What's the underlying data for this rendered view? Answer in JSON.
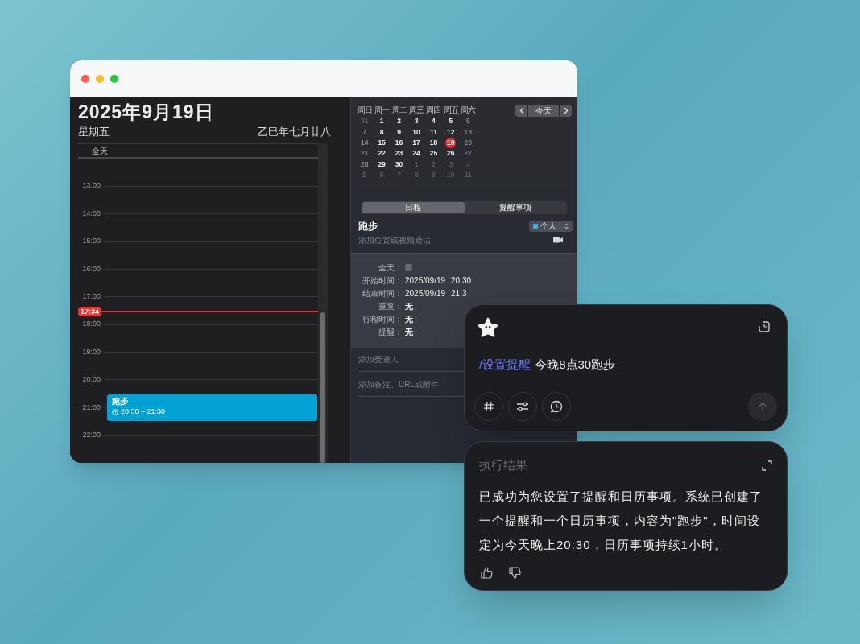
{
  "day_view": {
    "date_title": "2025年9月19日",
    "weekday": "星期五",
    "lunar_date": "乙巳年七月廿八",
    "all_day_label": "全天",
    "hours": [
      "13:00",
      "14:00",
      "15:00",
      "16:00",
      "17:00",
      "18:00",
      "19:00",
      "20:00",
      "21:00",
      "22:00"
    ],
    "current_time": "17:34",
    "events": [
      {
        "title": "跑步",
        "time": "20:30 – 21:30"
      }
    ]
  },
  "mini_calendar": {
    "weekdays": [
      "周日",
      "周一",
      "周二",
      "周三",
      "周四",
      "周五",
      "周六"
    ],
    "weeks": [
      [
        {
          "day": "31",
          "in_month": false,
          "selected": false
        },
        {
          "day": "1",
          "in_month": true,
          "selected": false
        },
        {
          "day": "2",
          "in_month": true,
          "selected": false
        },
        {
          "day": "3",
          "in_month": true,
          "selected": false
        },
        {
          "day": "4",
          "in_month": true,
          "selected": false
        },
        {
          "day": "5",
          "in_month": true,
          "selected": false
        },
        {
          "day": "6",
          "in_month": true,
          "selected": false
        }
      ],
      [
        {
          "day": "7",
          "in_month": true,
          "selected": false
        },
        {
          "day": "8",
          "in_month": true,
          "selected": false
        },
        {
          "day": "9",
          "in_month": true,
          "selected": false
        },
        {
          "day": "10",
          "in_month": true,
          "selected": false
        },
        {
          "day": "11",
          "in_month": true,
          "selected": false
        },
        {
          "day": "12",
          "in_month": true,
          "selected": false
        },
        {
          "day": "13",
          "in_month": true,
          "selected": false
        }
      ],
      [
        {
          "day": "14",
          "in_month": true,
          "selected": false
        },
        {
          "day": "15",
          "in_month": true,
          "selected": false
        },
        {
          "day": "16",
          "in_month": true,
          "selected": false
        },
        {
          "day": "17",
          "in_month": true,
          "selected": false
        },
        {
          "day": "18",
          "in_month": true,
          "selected": false
        },
        {
          "day": "19",
          "in_month": true,
          "selected": true
        },
        {
          "day": "20",
          "in_month": true,
          "selected": false
        }
      ],
      [
        {
          "day": "21",
          "in_month": true,
          "selected": false
        },
        {
          "day": "22",
          "in_month": true,
          "selected": false
        },
        {
          "day": "23",
          "in_month": true,
          "selected": false
        },
        {
          "day": "24",
          "in_month": true,
          "selected": false
        },
        {
          "day": "25",
          "in_month": true,
          "selected": false
        },
        {
          "day": "26",
          "in_month": true,
          "selected": false
        },
        {
          "day": "27",
          "in_month": true,
          "selected": false
        }
      ],
      [
        {
          "day": "28",
          "in_month": true,
          "selected": false
        },
        {
          "day": "29",
          "in_month": true,
          "selected": false
        },
        {
          "day": "30",
          "in_month": true,
          "selected": false
        },
        {
          "day": "1",
          "in_month": false,
          "selected": false
        },
        {
          "day": "2",
          "in_month": false,
          "selected": false
        },
        {
          "day": "3",
          "in_month": false,
          "selected": false
        },
        {
          "day": "4",
          "in_month": false,
          "selected": false
        }
      ],
      [
        {
          "day": "5",
          "in_month": false,
          "selected": false
        },
        {
          "day": "6",
          "in_month": false,
          "selected": false
        },
        {
          "day": "7",
          "in_month": false,
          "selected": false
        },
        {
          "day": "8",
          "in_month": false,
          "selected": false
        },
        {
          "day": "9",
          "in_month": false,
          "selected": false
        },
        {
          "day": "10",
          "in_month": false,
          "selected": false
        },
        {
          "day": "11",
          "in_month": false,
          "selected": false
        }
      ]
    ],
    "today_button": "今天"
  },
  "tabs": [
    {
      "label": "日程",
      "selected": true
    },
    {
      "label": "提醒事项",
      "selected": false
    }
  ],
  "event_editor": {
    "title": "跑步",
    "calendar": "个人",
    "location_placeholder": "添加位置或视频通话",
    "details": [
      {
        "kind": "checkbox",
        "label": "全天：",
        "checked": false
      },
      {
        "kind": "datetime",
        "label": "开始时间：",
        "date": "2025/09/19",
        "time": "20:30"
      },
      {
        "kind": "datetime",
        "label": "结束时间：",
        "date": "2025/09/19",
        "time": "21:3"
      },
      {
        "kind": "text",
        "label": "重复：",
        "value": "无"
      },
      {
        "kind": "text",
        "label": "行程时间：",
        "value": "无"
      },
      {
        "kind": "text",
        "label": "提醒：",
        "value": "无"
      }
    ],
    "invitees_placeholder": "添加受邀人",
    "notes_placeholder": "添加备注、URL或附件"
  },
  "prompt_card": {
    "command": "/设置提醒",
    "text": "今晚8点30跑步",
    "send_disabled": true
  },
  "result_card": {
    "title": "执行结果",
    "body": "已成功为您设置了提醒和日历事项。系统已创建了一个提醒和一个日历事项，内容为\"跑步\"，时间设定为今天晚上20:30，日历事项持续1小时。"
  }
}
